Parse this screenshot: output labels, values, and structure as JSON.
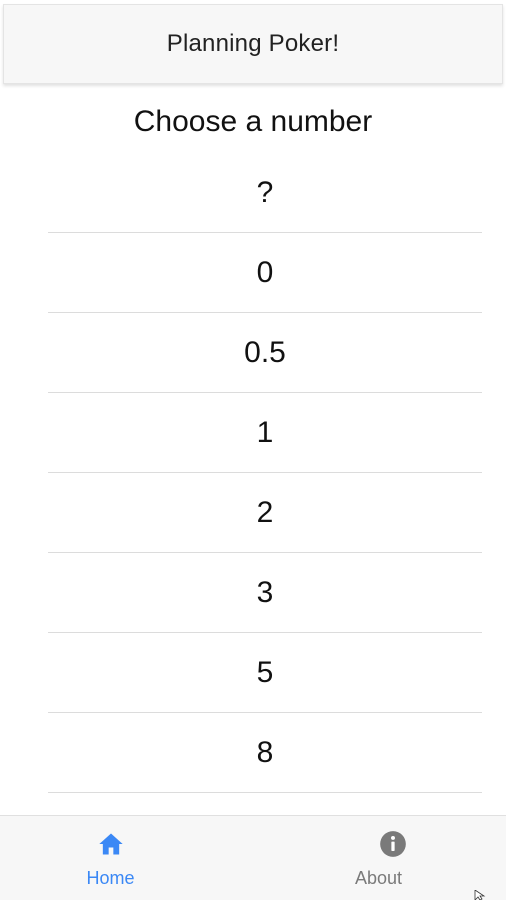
{
  "header": {
    "title": "Planning Poker!"
  },
  "main": {
    "heading": "Choose a number",
    "numbers": [
      "?",
      "0",
      "0.5",
      "1",
      "2",
      "3",
      "5",
      "8"
    ]
  },
  "tabs": [
    {
      "label": "Home",
      "icon": "home-icon",
      "active": true
    },
    {
      "label": "About",
      "icon": "info-icon",
      "active": false
    }
  ],
  "colors": {
    "active_tab": "#3b88f5",
    "inactive_tab": "#7a7a7a",
    "header_bg": "#f7f7f7"
  }
}
